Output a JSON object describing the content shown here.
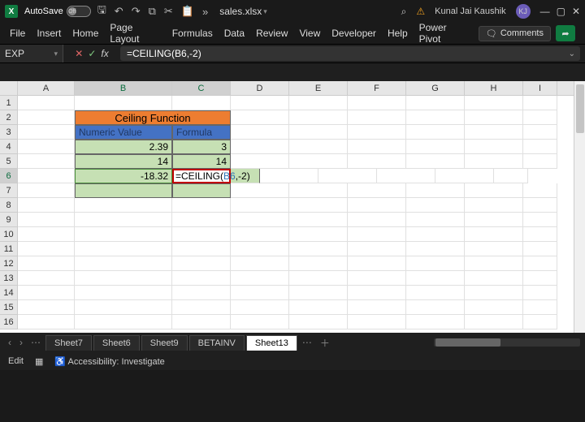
{
  "title": {
    "autosave_label": "AutoSave",
    "autosave_state": "Off",
    "filename": "sales.xlsx",
    "search_icon": "⌕",
    "user_name": "Kunal Jai Kaushik",
    "user_initials": "KJ"
  },
  "ribbon": {
    "tabs": [
      "File",
      "Insert",
      "Home",
      "Page Layout",
      "Formulas",
      "Data",
      "Review",
      "View",
      "Developer",
      "Help",
      "Power Pivot"
    ],
    "comments": "Comments"
  },
  "namebox": "EXP",
  "formula": "=CEILING(B6,-2)",
  "edit_cell": {
    "prefix": "=CEILING(",
    "ref": "B6",
    "suffix": ",-2)"
  },
  "table": {
    "title": "Ceiling Function",
    "headers": [
      "Numeric Value",
      "Formula"
    ],
    "rows": [
      {
        "value": "2.39",
        "formula": "3"
      },
      {
        "value": "14",
        "formula": "14"
      },
      {
        "value": "-18.32",
        "formula": ""
      }
    ]
  },
  "sheets": [
    "Sheet7",
    "Sheet6",
    "Sheet9",
    "BETAINV",
    "Sheet13"
  ],
  "active_sheet": 4,
  "status": {
    "mode": "Edit",
    "accessibility": "Accessibility: Investigate"
  },
  "cols": [
    "A",
    "B",
    "C",
    "D",
    "E",
    "F",
    "G",
    "H",
    "I"
  ],
  "chart_data": {
    "type": "table",
    "title": "Ceiling Function",
    "columns": [
      "Numeric Value",
      "Formula"
    ],
    "rows": [
      [
        2.39,
        3
      ],
      [
        14,
        14
      ],
      [
        -18.32,
        null
      ]
    ]
  }
}
